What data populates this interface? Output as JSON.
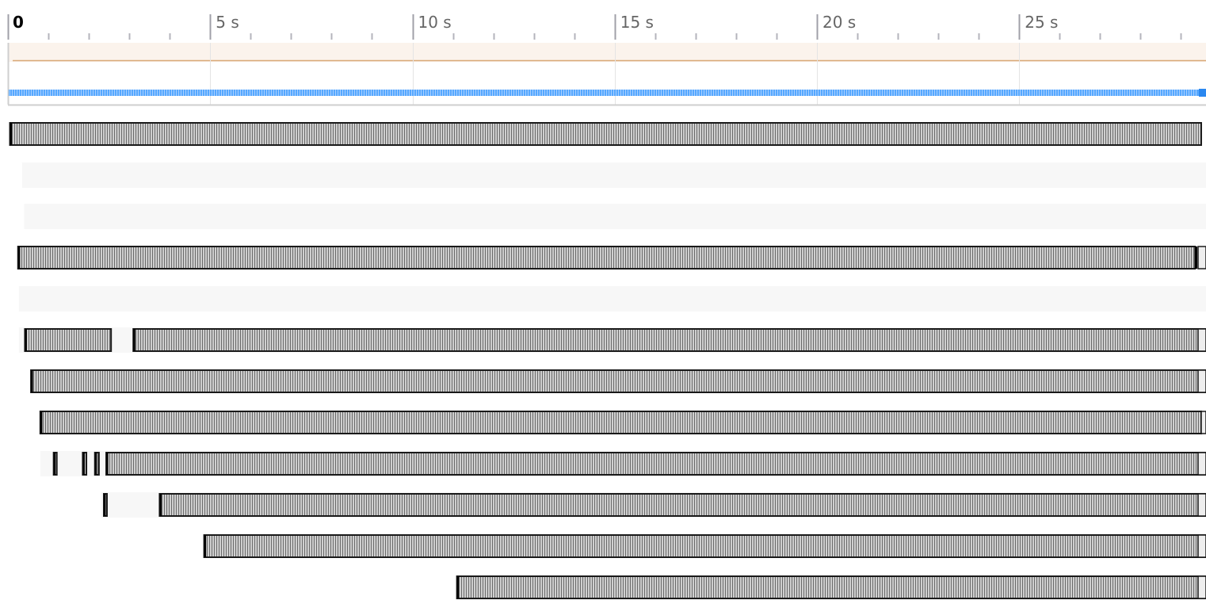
{
  "ruler": {
    "labels": [
      "0",
      "5 s",
      "10 s",
      "15 s",
      "20 s",
      "25 s"
    ],
    "unit": "s",
    "major_every_s": 5,
    "minor_every_s": 1,
    "visible_range_s": [
      0,
      29.6
    ]
  },
  "overview": {
    "fps_line_color": "#d9a877",
    "fps_band_color": "#fbf3ec",
    "activity_track_color": "#56a8ff",
    "activity_track_end_color": "#2a88f0"
  },
  "colors": {
    "bar_stripe_light": "#cfcfcf",
    "bar_stripe_dark": "#6a6a6a",
    "bar_outline": "#1a1a1a",
    "row_background": "#f7f7f7"
  },
  "rows": [
    {
      "segments": [
        [
          0.05,
          29.5
        ]
      ],
      "background": false,
      "stub": false
    },
    {
      "segments": [],
      "background": true,
      "bg_start": 0.35
    },
    {
      "segments": [],
      "background": true,
      "bg_start": 0.4
    },
    {
      "segments": [
        [
          0.25,
          29.35
        ]
      ],
      "background": false,
      "stub": true,
      "end_marker": true
    },
    {
      "segments": [],
      "background": true,
      "bg_start": 0.27
    },
    {
      "segments": [
        [
          0.42,
          2.55
        ],
        [
          3.1,
          29.6
        ]
      ],
      "background": true,
      "bg_start": 0.27,
      "stub": true
    },
    {
      "segments": [
        [
          0.57,
          29.6
        ]
      ],
      "background": false,
      "stub": true
    },
    {
      "segments": [
        [
          0.8,
          29.5
        ]
      ],
      "background": false,
      "stub": true,
      "stub_start": 29.5
    },
    {
      "segments": [
        [
          1.13,
          1.2
        ],
        [
          1.85,
          1.94
        ],
        [
          2.15,
          2.25
        ],
        [
          2.43,
          29.6
        ]
      ],
      "background": true,
      "bg_start": 0.8,
      "stub": true
    },
    {
      "segments": [
        [
          2.37,
          2.43
        ],
        [
          3.75,
          29.6
        ]
      ],
      "background": true,
      "bg_start": 2.3,
      "stub": true
    },
    {
      "segments": [
        [
          4.85,
          29.6
        ]
      ],
      "background": false,
      "stub": true
    },
    {
      "segments": [
        [
          11.1,
          29.6
        ]
      ],
      "background": false,
      "stub": true
    }
  ]
}
